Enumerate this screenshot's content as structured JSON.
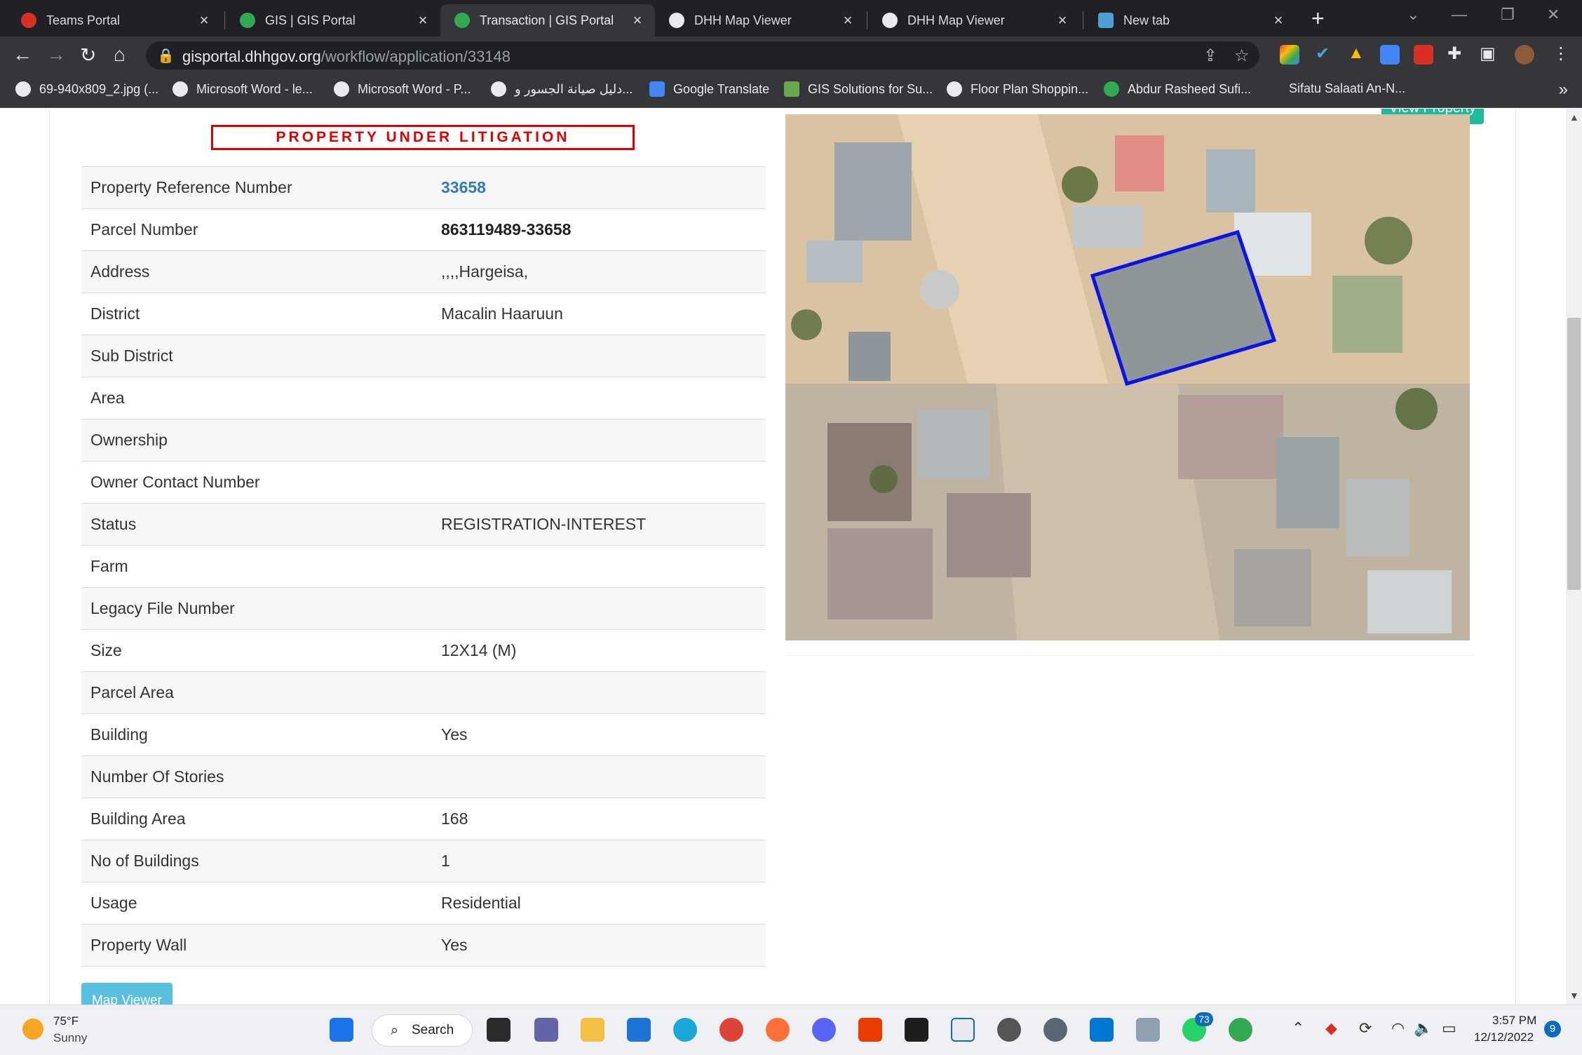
{
  "tabs": [
    {
      "title": "Teams Portal",
      "icon": "teams-portal-icon",
      "color": "#d93025"
    },
    {
      "title": "GIS | GIS Portal",
      "icon": "gis-portal-icon",
      "color": "#34a853"
    },
    {
      "title": "Transaction | GIS Portal",
      "icon": "gis-portal-icon",
      "color": "#34a853",
      "active": true
    },
    {
      "title": "DHH Map Viewer",
      "icon": "globe-icon",
      "color": "#e8eaed"
    },
    {
      "title": "DHH Map Viewer",
      "icon": "globe-icon",
      "color": "#e8eaed"
    },
    {
      "title": "New tab",
      "icon": "new-tab-icon",
      "color": "#4f9fd6"
    }
  ],
  "address_bar": {
    "host": "gisportal.dhhgov.org",
    "path": "/workflow/application/33148"
  },
  "bookmarks": [
    "69-940x809_2.jpg (...",
    "Microsoft Word - le...",
    "Microsoft Word - P...",
    "دليل صيانة الجسور و...",
    "Google Translate",
    "GIS Solutions for Su...",
    "Floor Plan Shoppin...",
    "Abdur Rasheed Sufi...",
    "Sifatu Salaati An-N..."
  ],
  "page": {
    "litigation_banner": "PROPERTY UNDER LITIGATION",
    "view_property_button": "View Property",
    "map_viewer_button": "Map Viewer",
    "property_rows": [
      {
        "label": "Property Reference Number",
        "value": "33658"
      },
      {
        "label": "Parcel Number",
        "value": "863119489-33658"
      },
      {
        "label": "Address",
        "value": ",,,,Hargeisa,"
      },
      {
        "label": "District",
        "value": "Macalin Haaruun"
      },
      {
        "label": "Sub District",
        "value": ""
      },
      {
        "label": "Area",
        "value": ""
      },
      {
        "label": "Ownership",
        "value": ""
      },
      {
        "label": "Owner Contact Number",
        "value": ""
      },
      {
        "label": "Status",
        "value": "REGISTRATION-INTEREST"
      },
      {
        "label": "Farm",
        "value": ""
      },
      {
        "label": "Legacy File Number",
        "value": ""
      },
      {
        "label": "Size",
        "value": "12X14 (M)"
      },
      {
        "label": "Parcel Area",
        "value": ""
      },
      {
        "label": "Building",
        "value": "Yes"
      },
      {
        "label": "Number Of Stories",
        "value": ""
      },
      {
        "label": "Building Area",
        "value": "168"
      },
      {
        "label": "No of Buildings",
        "value": "1"
      },
      {
        "label": "Usage",
        "value": "Residential"
      },
      {
        "label": "Property Wall",
        "value": "Yes"
      }
    ],
    "parcel_outline_color": "#0a14e6",
    "litigation_color": "#e00000"
  },
  "taskbar": {
    "weather_temp": "75°F",
    "weather_desc": "Sunny",
    "search_label": "Search",
    "whatsapp_badge": "73",
    "time": "3:57 PM",
    "date": "12/12/2022",
    "notification_count": "9"
  }
}
